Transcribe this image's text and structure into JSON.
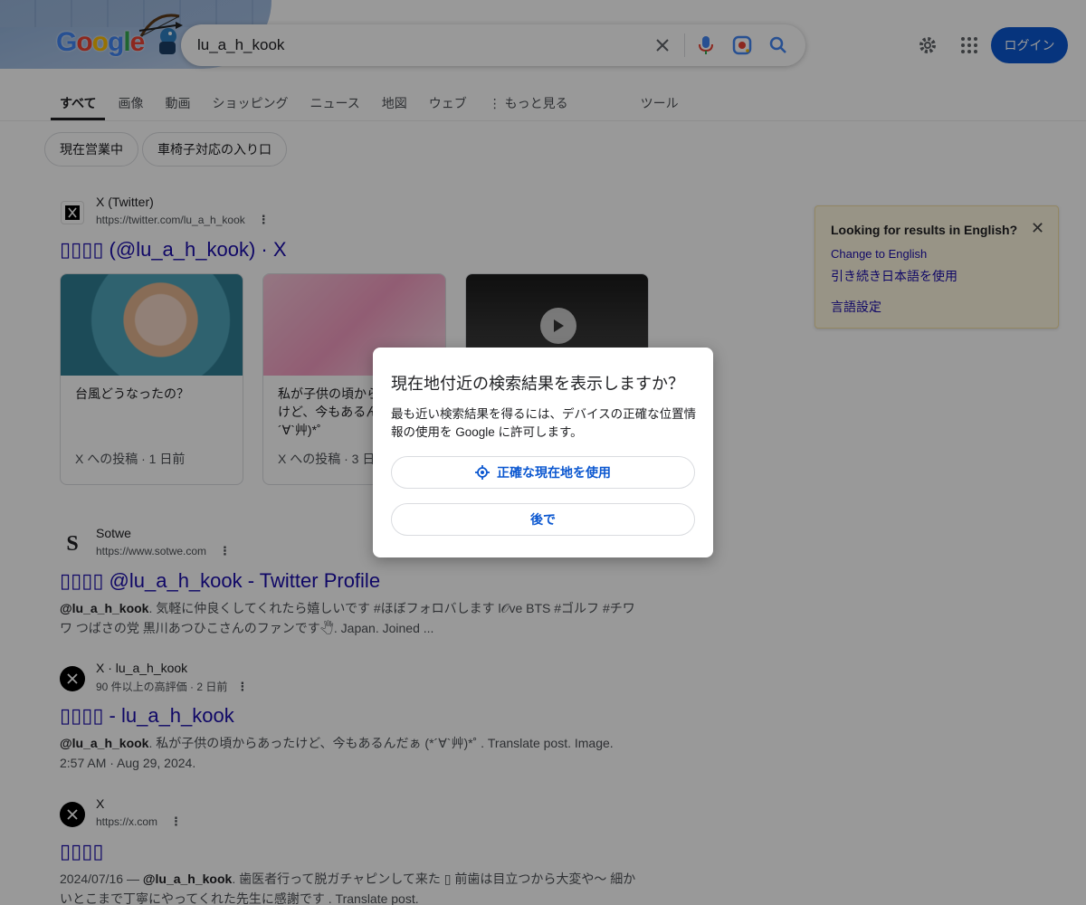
{
  "search": {
    "query": "lu_a_h_kook"
  },
  "header": {
    "logo_text": "Google",
    "login_label": "ログイン"
  },
  "tabs": [
    {
      "label": "すべて"
    },
    {
      "label": "画像"
    },
    {
      "label": "動画"
    },
    {
      "label": "ショッピング"
    },
    {
      "label": "ニュース"
    },
    {
      "label": "地図"
    },
    {
      "label": "ウェブ"
    },
    {
      "label": "⋮ もっと見る"
    },
    {
      "label": "ツール"
    }
  ],
  "chips": [
    {
      "label": "現在営業中"
    },
    {
      "label": "車椅子対応の入り口"
    }
  ],
  "results": [
    {
      "site": "X (Twitter)",
      "url": "https://twitter.com/lu_a_h_kook",
      "title": "▯▯▯▯ (@lu_a_h_kook) · X",
      "cards": [
        {
          "text": "台風どうなったの？",
          "meta": "X への投稿 · 1 日前"
        },
        {
          "text": "私が子供の頃から あったけど、今もあるんだぁ (*´∀`艸)*˚",
          "meta": "X への投稿 · 3 日前"
        },
        {
          "text": "",
          "meta": ""
        }
      ]
    },
    {
      "site": "Sotwe",
      "url": "https://www.sotwe.com",
      "title": "▯▯▯▯ @lu_a_h_kook - Twitter Profile",
      "snippet_lead": "@lu_a_h_kook",
      "snippet": ". 気軽に仲良くしてくれたら嬉しいです #ほぼフォロバします l𝒪ve BTS #ゴルフ #チワワ つばさの党 黒川あつひこさんのファンです🖑. Japan. Joined ..."
    },
    {
      "site": "X · lu_a_h_kook",
      "url": "90 件以上の高評価 · 2 日前",
      "title": "▯▯▯▯ - lu_a_h_kook",
      "snippet_lead": "@lu_a_h_kook",
      "snippet": ". 私が子供の頃からあったけど、今もあるんだぁ (*´∀`艸)*˚ . Translate post. Image. 2:57 AM · Aug 29, 2024."
    },
    {
      "site": "X",
      "url": "https://x.com",
      "title": "▯▯▯▯",
      "snippet_prefix": "2024/07/16 — ",
      "snippet_lead": "@lu_a_h_kook",
      "snippet": ". 歯医者行って脱ガチャピンして来た ▯ 前歯は目立つから大変や〜 細かいとこまで丁寧にやってくれた先生に感謝です . Translate post."
    }
  ],
  "lang_panel": {
    "question": "Looking for results in English?",
    "change": "Change to English",
    "keep": "引き続き日本語を使用",
    "settings": "言語設定"
  },
  "modal": {
    "title": "現在地付近の検索結果を表示しますか？",
    "body": "最も近い検索結果を得るには、デバイスの正確な位置情報の使用を Google に許可します。",
    "use_location": "正確な現在地を使用",
    "later": "後で"
  },
  "colors": {
    "link": "#1a0dab",
    "accent": "#0b57d0",
    "overlay": "rgba(0,0,0,0.40)"
  }
}
